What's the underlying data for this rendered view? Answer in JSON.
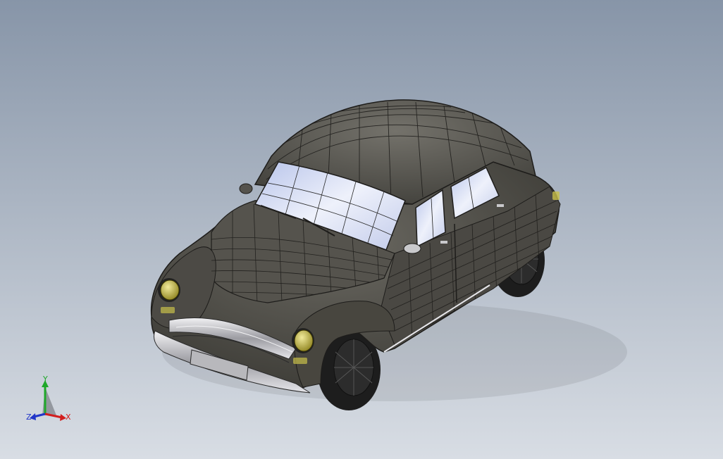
{
  "viewport": {
    "background_top": "#8795a8",
    "background_bottom": "#d8dde4"
  },
  "model": {
    "body_color": "#4a4843",
    "body_highlight": "#6b6962",
    "wire_color": "#1e1d1b",
    "glass_color": "#cfd7ee",
    "chrome_color": "#c9c9cc",
    "headlight_color": "#c8bf4a",
    "tire_color": "#1d1d1d"
  },
  "triad": {
    "x_label": "X",
    "y_label": "Y",
    "z_label": "Z",
    "x_color": "#d21e1e",
    "y_color": "#1fa82a",
    "z_color": "#2236c8"
  }
}
